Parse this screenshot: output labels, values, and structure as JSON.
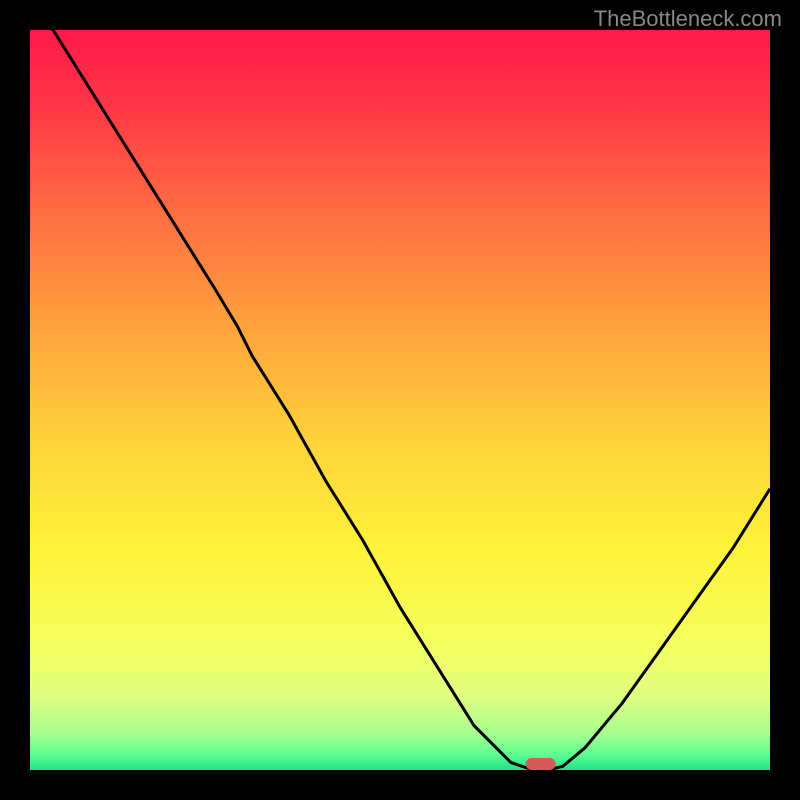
{
  "watermark": "TheBottleneck.com",
  "chart_data": {
    "type": "line",
    "title": "",
    "xlabel": "",
    "ylabel": "",
    "xlim": [
      0,
      100
    ],
    "ylim": [
      0,
      100
    ],
    "grid": false,
    "legend": false,
    "x": [
      0,
      5,
      10,
      15,
      20,
      25,
      28,
      30,
      35,
      40,
      45,
      50,
      55,
      60,
      65,
      68,
      70,
      72,
      75,
      80,
      85,
      90,
      95,
      100
    ],
    "y": [
      105,
      97,
      89,
      81,
      73,
      65,
      60,
      56,
      48,
      39,
      31,
      22,
      14,
      6,
      1,
      0,
      0,
      0.5,
      3,
      9,
      16,
      23,
      30,
      38
    ],
    "marker": {
      "x": 69,
      "y": 0
    },
    "background": "vertical-rainbow-gradient"
  }
}
